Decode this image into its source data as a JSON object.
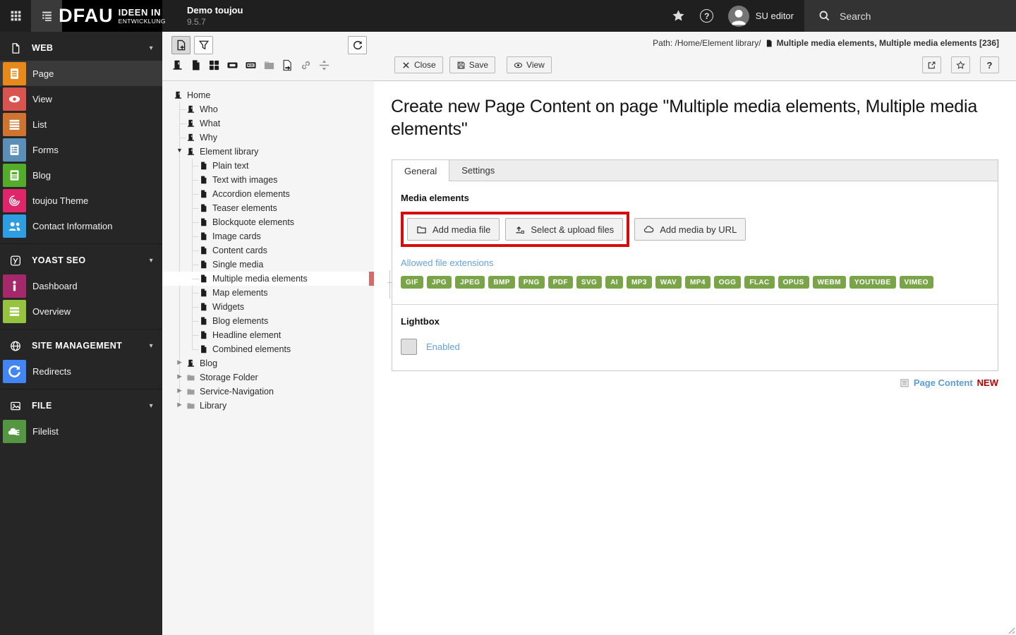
{
  "topbar": {
    "logo": {
      "primary": "DFAU",
      "tagline_line1": "IDEEN IN",
      "tagline_line2": "ENTWICKLUNG"
    },
    "site_title": "Demo toujou",
    "site_version": "9.5.7",
    "user_label": "SU editor",
    "search_label": "Search"
  },
  "sidebar": {
    "sections": [
      {
        "label": "WEB",
        "items": [
          {
            "label": "Page"
          },
          {
            "label": "View"
          },
          {
            "label": "List"
          },
          {
            "label": "Forms"
          },
          {
            "label": "Blog"
          },
          {
            "label": "toujou Theme"
          },
          {
            "label": "Contact Information"
          }
        ]
      },
      {
        "label": "YOAST SEO",
        "items": [
          {
            "label": "Dashboard"
          },
          {
            "label": "Overview"
          }
        ]
      },
      {
        "label": "SITE MANAGEMENT",
        "items": [
          {
            "label": "Redirects"
          }
        ]
      },
      {
        "label": "FILE",
        "items": [
          {
            "label": "Filelist"
          }
        ]
      }
    ]
  },
  "pagetree": {
    "nodes": [
      {
        "label": "Home"
      },
      {
        "label": "Who"
      },
      {
        "label": "What"
      },
      {
        "label": "Why"
      },
      {
        "label": "Element library"
      },
      {
        "label": "Plain text"
      },
      {
        "label": "Text with images"
      },
      {
        "label": "Accordion elements"
      },
      {
        "label": "Teaser elements"
      },
      {
        "label": "Blockquote elements"
      },
      {
        "label": "Image cards"
      },
      {
        "label": "Content cards"
      },
      {
        "label": "Single media"
      },
      {
        "label": "Multiple media elements"
      },
      {
        "label": "Map elements"
      },
      {
        "label": "Widgets"
      },
      {
        "label": "Blog elements"
      },
      {
        "label": "Headline element"
      },
      {
        "label": "Combined elements"
      },
      {
        "label": "Blog"
      },
      {
        "label": "Storage Folder"
      },
      {
        "label": "Service-Navigation"
      },
      {
        "label": "Library"
      }
    ]
  },
  "docheader": {
    "path_prefix": "Path: /Home/Element library/",
    "path_record": "Multiple media elements, Multiple media elements [236]",
    "close_label": "Close",
    "save_label": "Save",
    "view_label": "View"
  },
  "content": {
    "title": "Create new Page Content on page \"Multiple media elements, Multiple media elements\"",
    "tabs": {
      "general": "General",
      "settings": "Settings"
    },
    "media": {
      "section_label": "Media elements",
      "add_media_file": "Add media file",
      "select_upload": "Select & upload files",
      "add_by_url": "Add media by URL",
      "allowed_label": "Allowed file extensions",
      "extensions": [
        "GIF",
        "JPG",
        "JPEG",
        "BMP",
        "PNG",
        "PDF",
        "SVG",
        "AI",
        "MP3",
        "WAV",
        "MP4",
        "OGG",
        "FLAC",
        "OPUS",
        "WEBM",
        "YOUTUBE",
        "VIMEO"
      ]
    },
    "lightbox": {
      "section_label": "Lightbox",
      "enabled_label": "Enabled"
    },
    "footer": {
      "record_label": "Page Content",
      "badge": "NEW"
    }
  },
  "colors": {
    "annotation_red": "#d60b0b",
    "badge_green": "#79a548",
    "link_blue": "#64a2e2",
    "new_red": "#bb0000",
    "tree_marker_red": "#d66a66"
  }
}
